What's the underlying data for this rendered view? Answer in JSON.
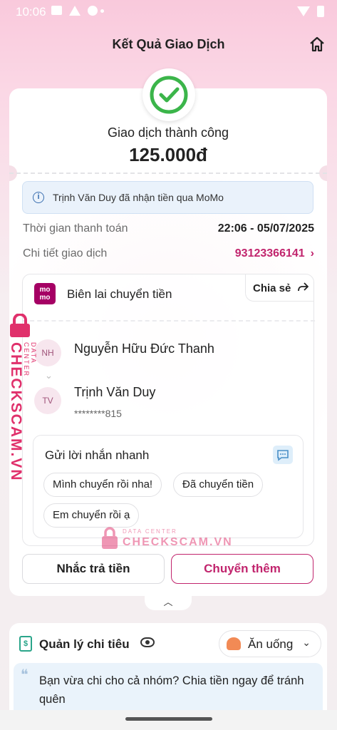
{
  "status_bar": {
    "time": "10:06"
  },
  "header": {
    "title": "Kết Quả Giao Dịch",
    "home_icon": "home-icon"
  },
  "result": {
    "status": "Giao dịch thành công",
    "amount": "125.000đ",
    "status_color": "#3bb54a",
    "info": "Trịnh Văn Duy đã nhận tiền qua MoMo"
  },
  "details": {
    "time_label": "Thời gian thanh toán",
    "time_value": "22:06 - 05/07/2025",
    "txn_label": "Chi tiết giao dịch",
    "txn_value": "93123366141"
  },
  "receipt": {
    "logo_text": "mo mo",
    "title": "Biên lai chuyển tiền",
    "share_label": "Chia sẻ",
    "sender": {
      "initials": "NH",
      "name": "Nguyễn Hữu Đức Thanh"
    },
    "receiver": {
      "initials": "TV",
      "name": "Trịnh Văn Duy",
      "account": "********815"
    },
    "quick_message": {
      "title": "Gửi lời nhắn nhanh",
      "chips": [
        "Mình chuyển rồi nha!",
        "Đã chuyển tiền",
        "Em chuyển rồi ạ"
      ]
    }
  },
  "actions": {
    "remind_label": "Nhắc trả tiền",
    "transfer_more_label": "Chuyển thêm"
  },
  "spending": {
    "title": "Quản lý chi tiêu",
    "category": "Ăn uống",
    "prompt": "Bạn vừa chi cho cả nhóm? Chia tiền ngay để tránh quên"
  },
  "watermark": {
    "brand": "CHECKSCAM.VN",
    "sub": "DATA CENTER"
  },
  "colors": {
    "accent": "#c1246d",
    "momo": "#a50064"
  }
}
